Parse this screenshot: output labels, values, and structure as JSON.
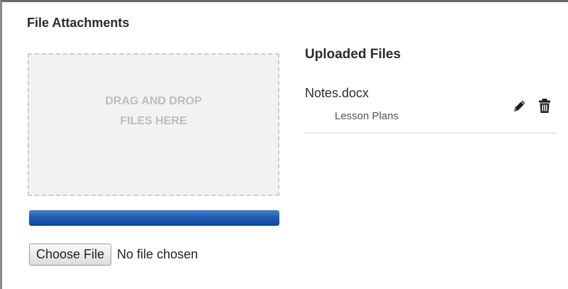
{
  "panel": {
    "title": "File Attachments"
  },
  "dropzone": {
    "line1": "DRAG AND DROP",
    "line2": "FILES HERE"
  },
  "progress": {
    "value": 1.0,
    "color": "#1e5eb3"
  },
  "file_input": {
    "button_label": "Choose File",
    "status": "No file chosen"
  },
  "uploaded": {
    "title": "Uploaded Files",
    "files": [
      {
        "name": "Notes.docx",
        "category": "Lesson Plans",
        "actions": [
          "pencil-icon",
          "trash-icon"
        ]
      }
    ]
  }
}
